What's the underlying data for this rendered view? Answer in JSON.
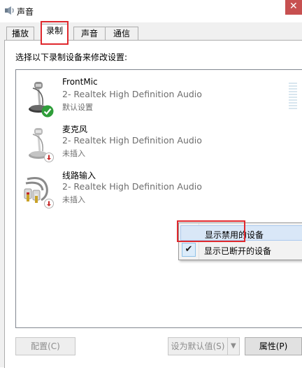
{
  "window": {
    "title": "声音",
    "close_glyph": "✕"
  },
  "tabs": [
    {
      "label": "播放",
      "active": false
    },
    {
      "label": "录制",
      "active": true
    },
    {
      "label": "声音",
      "active": false
    },
    {
      "label": "通信",
      "active": false
    }
  ],
  "instruction": "选择以下录制设备来修改设置:",
  "devices": [
    {
      "name": "FrontMic",
      "description": "2- Realtek High Definition Audio",
      "status": "默认设置",
      "icon": "microphone-icon",
      "badge": "default-check-badge"
    },
    {
      "name": "麦克风",
      "description": "2- Realtek High Definition Audio",
      "status": "未插入",
      "icon": "microphone-icon",
      "badge": "unplugged-badge"
    },
    {
      "name": "线路输入",
      "description": "2- Realtek High Definition Audio",
      "status": "未插入",
      "icon": "line-in-cable-icon",
      "badge": "unplugged-badge"
    }
  ],
  "context_menu": {
    "items": [
      {
        "label": "显示禁用的设备",
        "checked": false,
        "hovered": true
      },
      {
        "label": "显示已断开的设备",
        "checked": true,
        "hovered": false
      }
    ],
    "check_glyph": "✔"
  },
  "buttons": {
    "configure": "配置(C)",
    "set_default": "设为默认值(S)",
    "properties": "属性(P)",
    "dropdown_glyph": "▼"
  },
  "colors": {
    "highlight_border": "#e0292e",
    "default_badge": "#2f9e3a",
    "unplugged_badge": "#c62828",
    "menu_hover": "#d9e7f7"
  }
}
